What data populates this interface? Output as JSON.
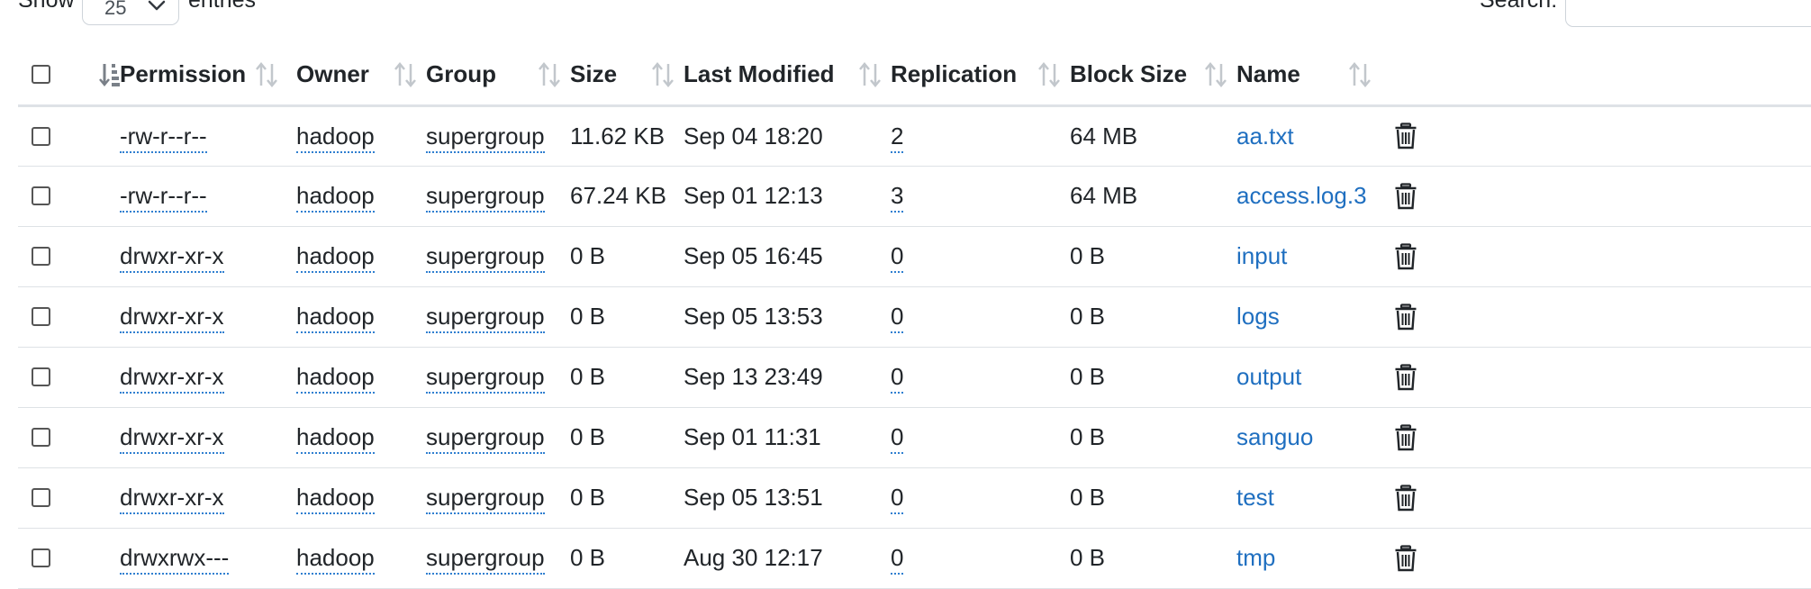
{
  "controls": {
    "show_label": "Show",
    "entries_value": "25",
    "entries_label": "entries",
    "search_label": "Search:",
    "search_value": ""
  },
  "table": {
    "headers": {
      "permission": "Permission",
      "owner": "Owner",
      "group": "Group",
      "size": "Size",
      "last_modified": "Last Modified",
      "replication": "Replication",
      "block_size": "Block Size",
      "name": "Name"
    },
    "rows": [
      {
        "permission": "-rw-r--r--",
        "owner": "hadoop",
        "group": "supergroup",
        "size": "11.62 KB",
        "last_modified": "Sep 04 18:20",
        "replication": "2",
        "block_size": "64 MB",
        "name": "aa.txt"
      },
      {
        "permission": "-rw-r--r--",
        "owner": "hadoop",
        "group": "supergroup",
        "size": "67.24 KB",
        "last_modified": "Sep 01 12:13",
        "replication": "3",
        "block_size": "64 MB",
        "name": "access.log.3"
      },
      {
        "permission": "drwxr-xr-x",
        "owner": "hadoop",
        "group": "supergroup",
        "size": "0 B",
        "last_modified": "Sep 05 16:45",
        "replication": "0",
        "block_size": "0 B",
        "name": "input"
      },
      {
        "permission": "drwxr-xr-x",
        "owner": "hadoop",
        "group": "supergroup",
        "size": "0 B",
        "last_modified": "Sep 05 13:53",
        "replication": "0",
        "block_size": "0 B",
        "name": "logs"
      },
      {
        "permission": "drwxr-xr-x",
        "owner": "hadoop",
        "group": "supergroup",
        "size": "0 B",
        "last_modified": "Sep 13 23:49",
        "replication": "0",
        "block_size": "0 B",
        "name": "output"
      },
      {
        "permission": "drwxr-xr-x",
        "owner": "hadoop",
        "group": "supergroup",
        "size": "0 B",
        "last_modified": "Sep 01 11:31",
        "replication": "0",
        "block_size": "0 B",
        "name": "sanguo"
      },
      {
        "permission": "drwxr-xr-x",
        "owner": "hadoop",
        "group": "supergroup",
        "size": "0 B",
        "last_modified": "Sep 05 13:51",
        "replication": "0",
        "block_size": "0 B",
        "name": "test"
      },
      {
        "permission": "drwxrwx---",
        "owner": "hadoop",
        "group": "supergroup",
        "size": "0 B",
        "last_modified": "Aug 30 12:17",
        "replication": "0",
        "block_size": "0 B",
        "name": "tmp"
      }
    ]
  },
  "icons": {
    "sort": "sort-icon",
    "sorted_desc": "sort-desc-icon",
    "delete": "trash-icon",
    "dropdown": "chevron-down-icon"
  },
  "colors": {
    "link": "#1f6fc0",
    "dotted_underline": "#2f7fd0",
    "text": "#212529",
    "sort_icon": "#c2c7cc",
    "active_sort_icon": "#7a8088"
  }
}
